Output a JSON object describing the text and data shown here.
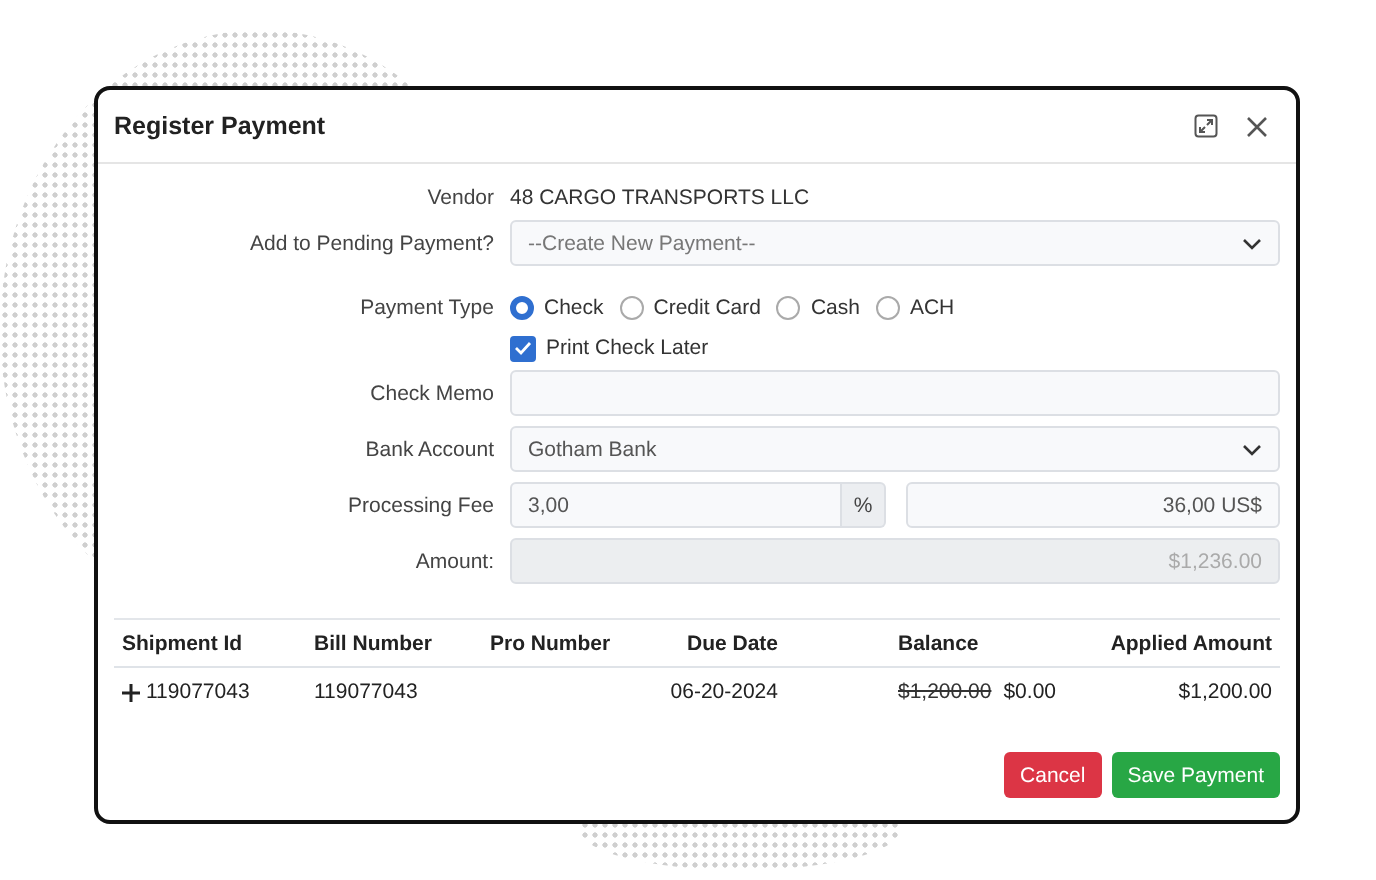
{
  "window": {
    "title": "Register Payment"
  },
  "form": {
    "vendor": {
      "label": "Vendor",
      "value": "48 CARGO TRANSPORTS LLC"
    },
    "pending_payment": {
      "label": "Add to Pending Payment?",
      "placeholder": "--Create New Payment--"
    },
    "payment_type": {
      "label": "Payment Type",
      "options": [
        {
          "label": "Check",
          "selected": true
        },
        {
          "label": "Credit Card",
          "selected": false
        },
        {
          "label": "Cash",
          "selected": false
        },
        {
          "label": "ACH",
          "selected": false
        }
      ]
    },
    "print_check_later": {
      "label": "Print Check Later",
      "checked": true
    },
    "check_memo": {
      "label": "Check Memo"
    },
    "bank_account": {
      "label": "Bank Account",
      "value": "Gotham Bank"
    },
    "processing_fee": {
      "label": "Processing Fee",
      "percent": "3,00",
      "unit": "%",
      "amount": "36,00 US$"
    },
    "amount": {
      "label": "Amount:",
      "value": "$1,236.00",
      "disabled": true
    }
  },
  "table": {
    "columns": [
      "Shipment Id",
      "Bill Number",
      "Pro Number",
      "Due Date",
      "Balance",
      "Applied Amount"
    ],
    "rows": [
      {
        "shipment_id": "119077043",
        "bill_number": "119077043",
        "due_date": "06-20-2024",
        "previous_balance": "$1,200.00",
        "balance": "$0.00",
        "applied_amount": "$1,200.00"
      }
    ]
  },
  "buttons": [
    {
      "label": "Cancel",
      "kind": "danger"
    },
    {
      "label": "Save Payment",
      "kind": "primary"
    }
  ]
}
